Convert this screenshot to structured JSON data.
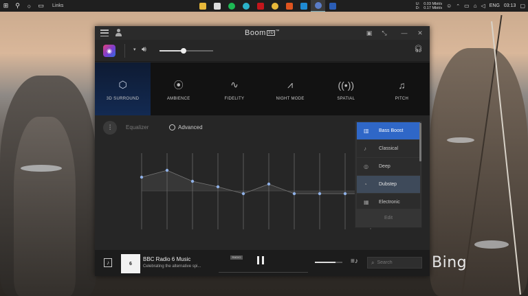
{
  "taskbar": {
    "links_label": "Links",
    "network": {
      "up_label": "U:",
      "down_label": "D:",
      "up": "0.03 Mbit/s",
      "down": "0.17 Mbit/s"
    },
    "language": "ENG",
    "time": "03:13"
  },
  "window": {
    "title": "Boom",
    "title_badge": "3D",
    "title_tm": "™"
  },
  "effects": [
    {
      "label": "3D SURROUND",
      "icon": "cube-icon",
      "active": true
    },
    {
      "label": "AMBIENCE",
      "icon": "ambience-icon",
      "active": false
    },
    {
      "label": "FIDELITY",
      "icon": "fidelity-icon",
      "active": false
    },
    {
      "label": "NIGHT MODE",
      "icon": "night-mode-icon",
      "active": false
    },
    {
      "label": "SPATIAL",
      "icon": "spatial-icon",
      "active": false
    },
    {
      "label": "PITCH",
      "icon": "music-note-icon",
      "active": false
    }
  ],
  "volume": {
    "level": 0.45
  },
  "equalizer": {
    "label": "Equalizer",
    "advanced_label": "Advanced",
    "advanced_checked": false,
    "bands": [
      0.5,
      0.75,
      0.35,
      0.15,
      -0.1,
      0.25,
      -0.1,
      -0.1,
      -0.1,
      -0.1
    ]
  },
  "presets": {
    "items": [
      {
        "label": "Bass Boost",
        "icon": "bass-boost-icon",
        "state": "selected"
      },
      {
        "label": "Classical",
        "icon": "guitar-icon",
        "state": "normal"
      },
      {
        "label": "Deep",
        "icon": "deep-icon",
        "state": "normal"
      },
      {
        "label": "Dubstep",
        "icon": "dubstep-icon",
        "state": "highlighted"
      },
      {
        "label": "Electronic",
        "icon": "electronic-icon",
        "state": "normal"
      }
    ],
    "edit_label": "Edit"
  },
  "player": {
    "station": "BBC Radio 6 Music",
    "subtitle": "Celebrating the alternative spi...",
    "art_text": "6",
    "tag": "RADIO",
    "search_placeholder": "Search"
  },
  "wallpaper": {
    "brand_text": "Bing"
  },
  "colors": {
    "accent": "#2f67c7",
    "active_effect": "#132a52",
    "window_bg": "#262626",
    "taskbar_bg": "#1f1f1f"
  }
}
